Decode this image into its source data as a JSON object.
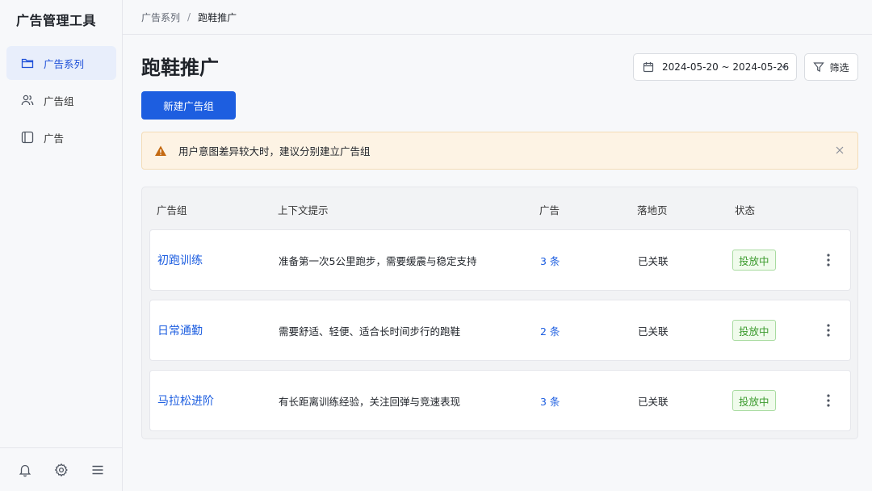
{
  "app": {
    "title": "广告管理工具"
  },
  "sidebar": {
    "items": [
      {
        "label": "广告系列",
        "icon": "folder-icon",
        "active": true
      },
      {
        "label": "广告组",
        "icon": "users-icon",
        "active": false
      },
      {
        "label": "广告",
        "icon": "panel-icon",
        "active": false
      }
    ],
    "footer": [
      "bell-icon",
      "gear-icon",
      "menu-icon"
    ]
  },
  "breadcrumb": {
    "parent": "广告系列",
    "separator": "/",
    "current": "跑鞋推广"
  },
  "page": {
    "title": "跑鞋推广",
    "date_range": "2024-05-20 ~ 2024-05-26",
    "filter_label": "筛选",
    "new_button": "新建广告组"
  },
  "alert": {
    "text": "用户意图差异较大时，建议分别建立广告组"
  },
  "table": {
    "headers": [
      "广告组",
      "上下文提示",
      "广告",
      "落地页",
      "状态"
    ],
    "rows": [
      {
        "name": "初跑训练",
        "hint": "准备第一次5公里跑步，需要缓震与稳定支持",
        "ads": "3 条",
        "landing": "已关联",
        "status": "投放中"
      },
      {
        "name": "日常通勤",
        "hint": "需要舒适、轻便、适合长时间步行的跑鞋",
        "ads": "2 条",
        "landing": "已关联",
        "status": "投放中"
      },
      {
        "name": "马拉松进阶",
        "hint": "有长距离训练经验，关注回弹与竞速表现",
        "ads": "3 条",
        "landing": "已关联",
        "status": "投放中"
      }
    ]
  },
  "colors": {
    "primary": "#1d5ee0",
    "success": "#3a9a2c",
    "warning": "#c46a12"
  }
}
